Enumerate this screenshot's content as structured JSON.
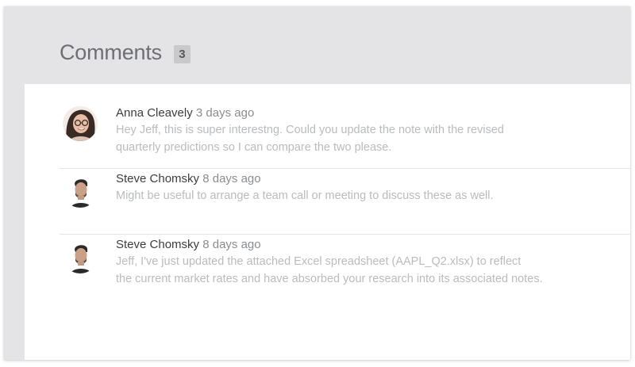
{
  "header": {
    "title": "Comments",
    "count": "3"
  },
  "comments": [
    {
      "author": "Anna Cleavely",
      "time": "3 days ago",
      "lines": [
        "Hey Jeff, this is super interestng. Could you update the note with the revised",
        "quarterly predictions so I can compare the two please."
      ]
    },
    {
      "author": "Steve Chomsky",
      "time": "8 days ago",
      "lines": [
        "Might be useful to arrange a team call or meeting to discuss these as well."
      ]
    },
    {
      "author": "Steve Chomsky",
      "time": "8 days ago",
      "lines": [
        "Jeff, I've just updated the attached Excel spreadsheet (AAPL_Q2.xlsx) to reflect",
        "the current market rates and have absorbed your research into its associated notes."
      ]
    }
  ]
}
